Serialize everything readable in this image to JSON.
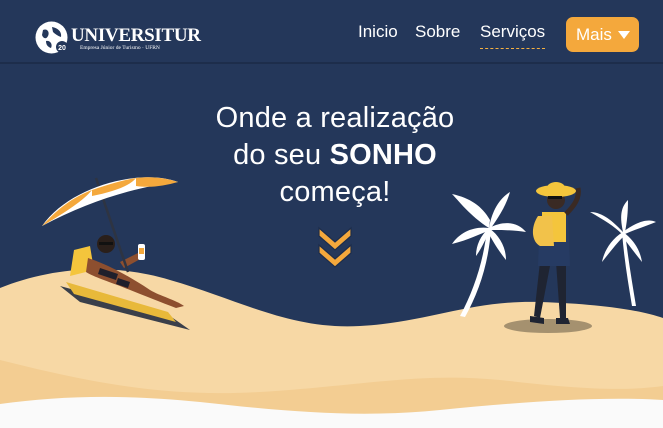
{
  "brand": {
    "name": "UNIVERSITUR",
    "tagline": "Empresa Júnior de Turismo · UFRN",
    "badge": "20"
  },
  "nav": {
    "items": [
      {
        "label": "Inicio"
      },
      {
        "label": "Sobre"
      },
      {
        "label": "Serviços",
        "active": true
      }
    ],
    "more_label": "Mais"
  },
  "hero": {
    "line1": "Onde a realização",
    "line2_prefix": "do seu ",
    "line2_emphasis": "SONHO",
    "line3": "começa!"
  },
  "icons": [
    "globe-logo-icon",
    "chevron-down-icon",
    "double-chevron-down-icon"
  ],
  "colors": {
    "navy": "#24375a",
    "accent": "#f4a83c",
    "sand": "#f7d8a5",
    "white": "#ffffff"
  }
}
